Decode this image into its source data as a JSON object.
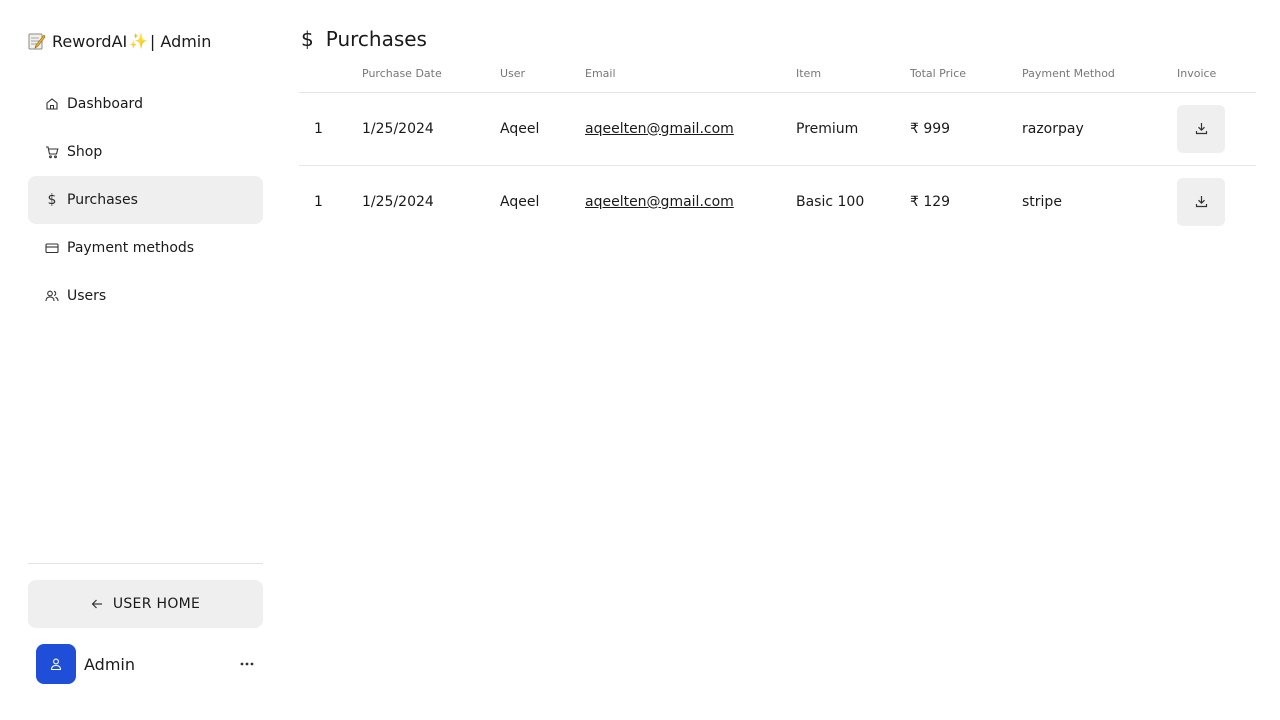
{
  "brand": {
    "name": "RewordAI",
    "suffix": "| Admin"
  },
  "sidebar": {
    "items": [
      {
        "label": "Dashboard",
        "icon": "home-icon",
        "active": false
      },
      {
        "label": "Shop",
        "icon": "cart-icon",
        "active": false
      },
      {
        "label": "Purchases",
        "icon": "dollar-icon",
        "active": true
      },
      {
        "label": "Payment methods",
        "icon": "credit-card-icon",
        "active": false
      },
      {
        "label": "Users",
        "icon": "users-icon",
        "active": false
      }
    ],
    "user_home_label": "USER HOME",
    "account_name": "Admin"
  },
  "page": {
    "title_icon": "$",
    "title": "Purchases"
  },
  "table": {
    "headers": [
      "",
      "Purchase Date",
      "User",
      "Email",
      "Item",
      "Total Price",
      "Payment Method",
      "Invoice"
    ],
    "rows": [
      {
        "id": "1",
        "date": "1/25/2024",
        "user": "Aqeel",
        "email": "aqeelten@gmail.com",
        "item": "Premium",
        "price": "₹ 999",
        "method": "razorpay"
      },
      {
        "id": "1",
        "date": "1/25/2024",
        "user": "Aqeel",
        "email": "aqeelten@gmail.com",
        "item": "Basic 100",
        "price": "₹ 129",
        "method": "stripe"
      }
    ]
  },
  "colors": {
    "accent": "#1f4fd8",
    "active_bg": "#efefef"
  }
}
